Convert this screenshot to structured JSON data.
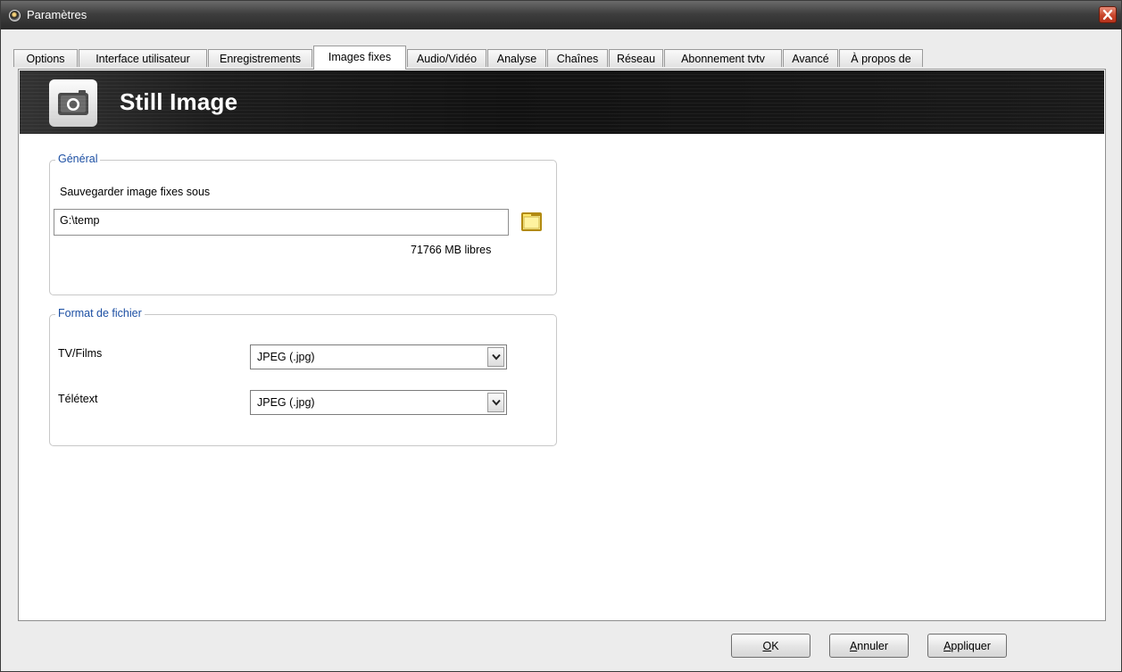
{
  "window": {
    "title": "Paramètres"
  },
  "icons": {
    "app": "app-icon",
    "close": "close-icon",
    "camera": "camera-icon",
    "folder": "folder-icon",
    "dropdown": "chevron-down-icon"
  },
  "tabs": [
    {
      "label": "Options"
    },
    {
      "label": "Interface utilisateur"
    },
    {
      "label": "Enregistrements"
    },
    {
      "label": "Images fixes",
      "active": true
    },
    {
      "label": "Audio/Vidéo"
    },
    {
      "label": "Analyse"
    },
    {
      "label": "Chaînes"
    },
    {
      "label": "Réseau"
    },
    {
      "label": "Abonnement tvtv"
    },
    {
      "label": "Avancé"
    },
    {
      "label": "À propos de"
    }
  ],
  "banner": {
    "title": "Still Image"
  },
  "general": {
    "legend": "Général",
    "save_label": "Sauvegarder image fixes sous",
    "path_value": "G:\\temp",
    "free_space": "71766 MB libres"
  },
  "format": {
    "legend": "Format de fichier",
    "tv_label": "TV/Films",
    "tv_value": "JPEG (.jpg)",
    "teletext_label": "Télétext",
    "teletext_value": "JPEG (.jpg)"
  },
  "buttons": {
    "ok": {
      "key": "O",
      "rest": "K"
    },
    "cancel": {
      "key": "A",
      "rest": "nnuler"
    },
    "apply": {
      "key": "A",
      "rest": "ppliquer"
    }
  },
  "colors": {
    "legend": "#1c4fa3",
    "close": "#c8452b",
    "titlebar": "#3e3e3e"
  }
}
